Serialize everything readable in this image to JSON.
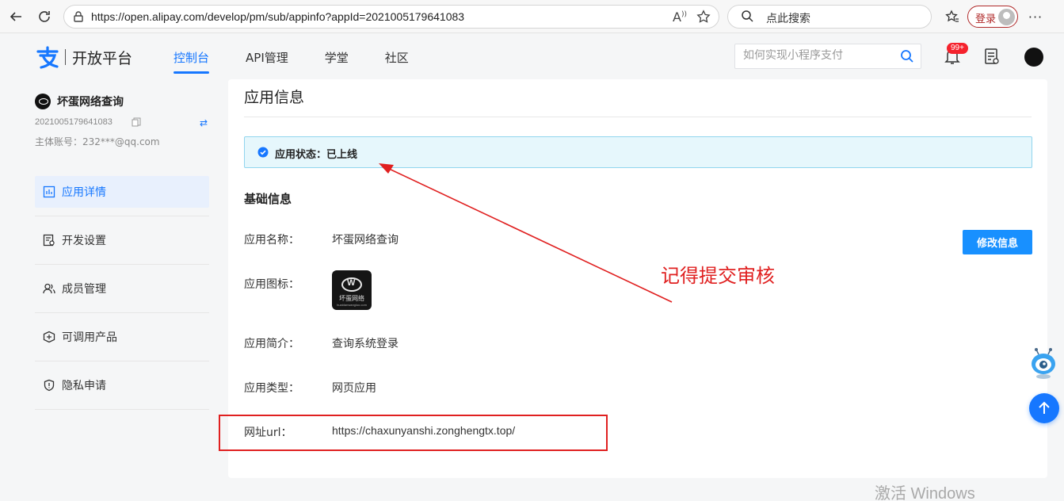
{
  "browser": {
    "url": "https://open.alipay.com/develop/pm/sub/appinfo?appId=2021005179641083",
    "search_text": "点此搜索",
    "login_label": "登录",
    "icons": [
      "back-icon",
      "refresh-icon",
      "lock-icon",
      "read-aloud-icon",
      "favorite-star-icon",
      "search-icon",
      "favorites-icon",
      "more-icon"
    ]
  },
  "header": {
    "logo_text": "开放平台",
    "nav": [
      {
        "label": "控制台",
        "active": true
      },
      {
        "label": "API管理",
        "active": false
      },
      {
        "label": "学堂",
        "active": false
      },
      {
        "label": "社区",
        "active": false
      }
    ],
    "search_placeholder": "如何实现小程序支付",
    "notification_badge": "99+",
    "accent_color": "#1677ff"
  },
  "sidebar": {
    "app_name": "坏蛋网络查询",
    "app_id": "2021005179641083",
    "account": "主体账号：232***@qq.com",
    "menu": [
      {
        "label": "应用详情",
        "icon": "chart-icon",
        "active": true
      },
      {
        "label": "开发设置",
        "icon": "settings-doc-icon",
        "active": false
      },
      {
        "label": "成员管理",
        "icon": "members-icon",
        "active": false
      },
      {
        "label": "可调用产品",
        "icon": "products-icon",
        "active": false
      },
      {
        "label": "隐私申请",
        "icon": "shield-icon",
        "active": false
      }
    ]
  },
  "main": {
    "title": "应用信息",
    "status": "应用状态：已上线",
    "section_title": "基础信息",
    "edit_button": "修改信息",
    "fields": {
      "name_label": "应用名称：",
      "name_value": "坏蛋网络查询",
      "icon_label": "应用图标：",
      "icon_caption": "坏蛋网络",
      "icon_subcaption": "huaidanwangluo.com",
      "intro_label": "应用简介：",
      "intro_value": "查询系统登录",
      "type_label": "应用类型：",
      "type_value": "网页应用",
      "url_label": "网址url：",
      "url_value": "https://chaxunyanshi.zonghengtx.top/"
    }
  },
  "annotation": {
    "text": "记得提交审核",
    "color": "#e02020"
  },
  "watermark": "激活 Windows"
}
